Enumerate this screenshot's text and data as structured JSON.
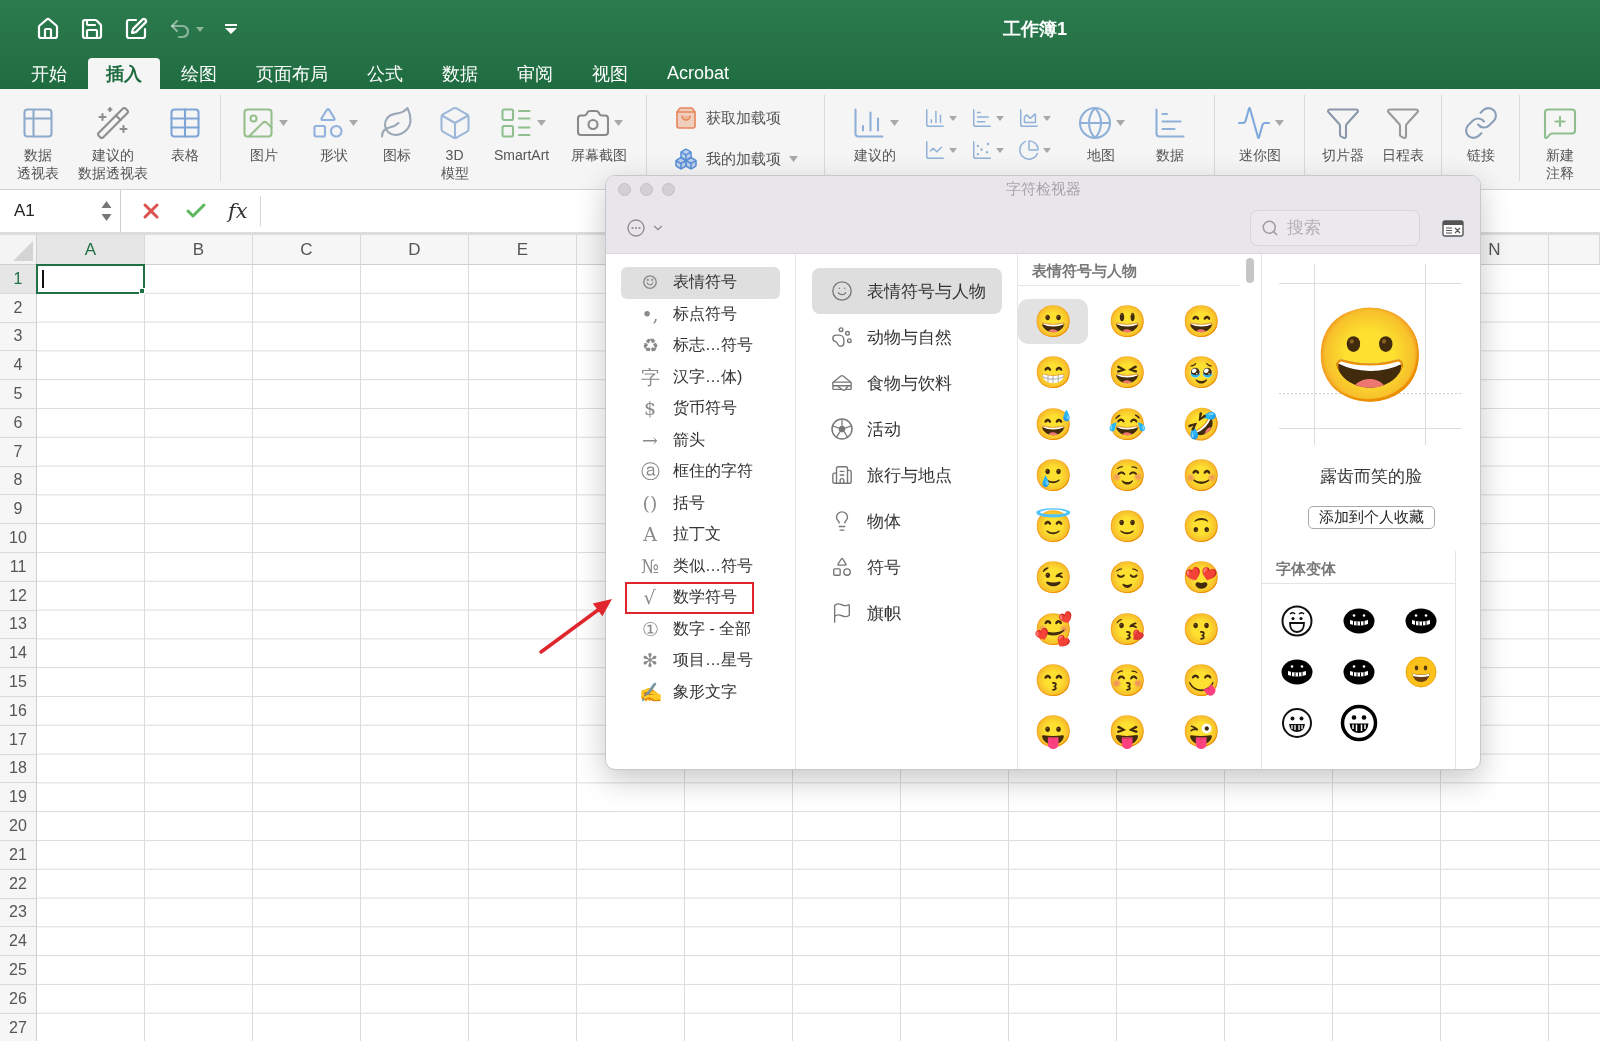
{
  "title_bar": {
    "title": "工作簿1",
    "quick_access": [
      {
        "disabled": false
      },
      {
        "disabled": false
      },
      {
        "disabled": false
      },
      {
        "disabled": true
      },
      {
        "disabled": false
      }
    ]
  },
  "tabs": [
    {
      "label": "开始",
      "selected": false
    },
    {
      "label": "插入",
      "selected": true
    },
    {
      "label": "绘图",
      "selected": false
    },
    {
      "label": "页面布局",
      "selected": false
    },
    {
      "label": "公式",
      "selected": false
    },
    {
      "label": "数据",
      "selected": false
    },
    {
      "label": "审阅",
      "selected": false
    },
    {
      "label": "视图",
      "selected": false
    },
    {
      "label": "Acrobat",
      "selected": false
    }
  ],
  "ribbon": {
    "groups": [
      {
        "kind": "large",
        "buttons": [
          {
            "lines": [
              "数据",
              "透视表"
            ],
            "has_menu": false
          },
          {
            "lines": [
              "建议的",
              "数据透视表"
            ],
            "has_menu": false
          },
          {
            "lines": [
              "表格"
            ],
            "has_menu": false
          }
        ]
      },
      {
        "kind": "large",
        "buttons": [
          {
            "lines": [
              "图片"
            ],
            "has_menu": true
          },
          {
            "lines": [
              "形状"
            ],
            "has_menu": true
          },
          {
            "lines": [
              "图标"
            ],
            "has_menu": false
          },
          {
            "lines": [
              "3D",
              "模型"
            ],
            "has_menu": false
          },
          {
            "lines": [
              "SmartArt"
            ],
            "has_menu": true
          },
          {
            "lines": [
              "屏幕截图"
            ],
            "has_menu": true
          }
        ]
      },
      {
        "kind": "small",
        "buttons": [
          {
            "lines": [
              "获取加载项"
            ],
            "has_menu": false
          },
          {
            "lines": [
              "我的加载项"
            ],
            "has_menu": true
          }
        ]
      },
      {
        "kind": "charts",
        "buttons": [
          {
            "lines": [
              "建议的"
            ],
            "has_menu": true
          },
          {
            "lines": [
              "地图"
            ],
            "has_menu": true
          },
          {
            "lines": [
              "数据"
            ],
            "has_menu": false
          }
        ]
      },
      {
        "kind": "large",
        "buttons": [
          {
            "lines": [
              "迷你图"
            ],
            "has_menu": true
          }
        ]
      },
      {
        "kind": "large",
        "buttons": [
          {
            "lines": [
              "切片器"
            ],
            "has_menu": false
          },
          {
            "lines": [
              "日程表"
            ],
            "has_menu": false
          }
        ]
      },
      {
        "kind": "large",
        "buttons": [
          {
            "lines": [
              "链接"
            ],
            "has_menu": false
          }
        ]
      },
      {
        "kind": "large",
        "buttons": [
          {
            "lines": [
              "新建",
              "注释"
            ],
            "has_menu": false
          }
        ]
      }
    ]
  },
  "formula_bar": {
    "name_box": "A1",
    "function_label": "fx"
  },
  "sheet": {
    "columns": [
      {
        "label": "A",
        "selected": true
      },
      {
        "label": "B",
        "selected": false
      },
      {
        "label": "C",
        "selected": false
      },
      {
        "label": "D",
        "selected": false
      },
      {
        "label": "E",
        "selected": false
      }
    ],
    "far_columns": [
      {
        "label": "N",
        "selected": false
      }
    ],
    "rows": [
      {
        "label": "1",
        "selected": true
      },
      {
        "label": "2",
        "selected": false
      },
      {
        "label": "3",
        "selected": false
      },
      {
        "label": "4",
        "selected": false
      },
      {
        "label": "5",
        "selected": false
      },
      {
        "label": "6",
        "selected": false
      },
      {
        "label": "7",
        "selected": false
      },
      {
        "label": "8",
        "selected": false
      },
      {
        "label": "9",
        "selected": false
      },
      {
        "label": "10",
        "selected": false
      },
      {
        "label": "11",
        "selected": false
      },
      {
        "label": "12",
        "selected": false
      },
      {
        "label": "13",
        "selected": false
      },
      {
        "label": "14",
        "selected": false
      },
      {
        "label": "15",
        "selected": false
      },
      {
        "label": "16",
        "selected": false
      },
      {
        "label": "17",
        "selected": false
      },
      {
        "label": "18",
        "selected": false
      },
      {
        "label": "19",
        "selected": false
      },
      {
        "label": "20",
        "selected": false
      },
      {
        "label": "21",
        "selected": false
      },
      {
        "label": "22",
        "selected": false
      },
      {
        "label": "23",
        "selected": false
      },
      {
        "label": "24",
        "selected": false
      },
      {
        "label": "25",
        "selected": false
      },
      {
        "label": "26",
        "selected": false
      },
      {
        "label": "27",
        "selected": false
      }
    ]
  },
  "character_viewer": {
    "title": "字符检视器",
    "search": {
      "placeholder": "搜索"
    },
    "sidebar": [
      {
        "glyph": "☺",
        "label": "表情符号",
        "selected": true,
        "highlighted": false
      },
      {
        "glyph": "•,",
        "label": "标点符号",
        "selected": false,
        "highlighted": false
      },
      {
        "glyph": "♻",
        "label": "标志…符号",
        "selected": false,
        "highlighted": false
      },
      {
        "glyph": "字",
        "label": "汉字…体)",
        "selected": false,
        "highlighted": false
      },
      {
        "glyph": "$",
        "label": "货币符号",
        "selected": false,
        "highlighted": false
      },
      {
        "glyph": "→",
        "label": "箭头",
        "selected": false,
        "highlighted": false
      },
      {
        "glyph": "ⓐ",
        "label": "框住的字符",
        "selected": false,
        "highlighted": false
      },
      {
        "glyph": "()",
        "label": "括号",
        "selected": false,
        "highlighted": false
      },
      {
        "glyph": "A",
        "label": "拉丁文",
        "selected": false,
        "highlighted": false
      },
      {
        "glyph": "№",
        "label": "类似…符号",
        "selected": false,
        "highlighted": false
      },
      {
        "glyph": "√",
        "label": "数学符号",
        "selected": false,
        "highlighted": true
      },
      {
        "glyph": "①",
        "label": "数字 - 全部",
        "selected": false,
        "highlighted": false
      },
      {
        "glyph": "✻",
        "label": "项目…星号",
        "selected": false,
        "highlighted": false
      },
      {
        "glyph": "✍",
        "label": "象形文字",
        "selected": false,
        "highlighted": false
      }
    ],
    "categories": [
      {
        "label": "表情符号与人物",
        "selected": true
      },
      {
        "label": "动物与自然",
        "selected": false
      },
      {
        "label": "食物与饮料",
        "selected": false
      },
      {
        "label": "活动",
        "selected": false
      },
      {
        "label": "旅行与地点",
        "selected": false
      },
      {
        "label": "物体",
        "selected": false
      },
      {
        "label": "符号",
        "selected": false
      },
      {
        "label": "旗帜",
        "selected": false
      }
    ],
    "grid": {
      "heading": "表情符号与人物",
      "items": [
        {
          "char": "😀",
          "selected": true
        },
        {
          "char": "😃",
          "selected": false
        },
        {
          "char": "😄",
          "selected": false
        },
        {
          "char": "😁",
          "selected": false
        },
        {
          "char": "😆",
          "selected": false
        },
        {
          "char": "🥹",
          "selected": false
        },
        {
          "char": "😅",
          "selected": false
        },
        {
          "char": "😂",
          "selected": false
        },
        {
          "char": "🤣",
          "selected": false
        },
        {
          "char": "🥲",
          "selected": false
        },
        {
          "char": "☺️",
          "selected": false
        },
        {
          "char": "😊",
          "selected": false
        },
        {
          "char": "😇",
          "selected": false
        },
        {
          "char": "🙂",
          "selected": false
        },
        {
          "char": "🙃",
          "selected": false
        },
        {
          "char": "😉",
          "selected": false
        },
        {
          "char": "😌",
          "selected": false
        },
        {
          "char": "😍",
          "selected": false
        },
        {
          "char": "🥰",
          "selected": false
        },
        {
          "char": "😘",
          "selected": false
        },
        {
          "char": "😗",
          "selected": false
        },
        {
          "char": "😙",
          "selected": false
        },
        {
          "char": "😚",
          "selected": false
        },
        {
          "char": "😋",
          "selected": false
        },
        {
          "char": "😛",
          "selected": false
        },
        {
          "char": "😝",
          "selected": false
        },
        {
          "char": "😜",
          "selected": false
        }
      ]
    },
    "detail": {
      "char": "😀",
      "name": "露齿而笑的脸",
      "button": "添加到个人收藏",
      "variants_heading": "字体变体",
      "variants": [
        {
          "kind": "cartoon"
        },
        {
          "kind": "solid"
        },
        {
          "kind": "solid"
        },
        {
          "kind": "solid"
        },
        {
          "kind": "solid"
        },
        {
          "kind": "color"
        },
        {
          "kind": "thin"
        },
        {
          "kind": "bold"
        }
      ]
    }
  }
}
